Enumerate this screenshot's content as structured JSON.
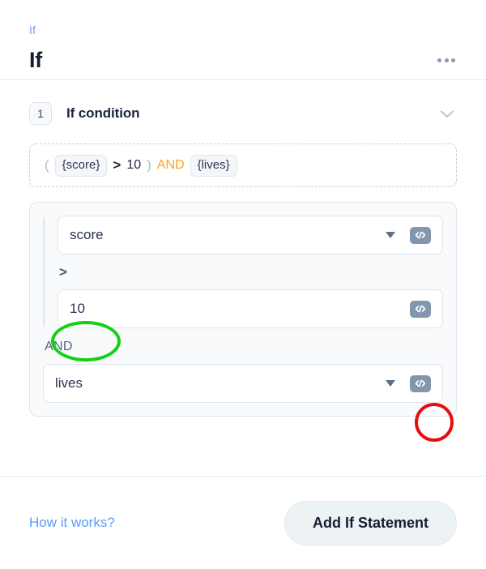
{
  "header": {
    "breadcrumb": "If",
    "title": "If",
    "menu_icon": "kebab-menu-icon"
  },
  "section": {
    "step_number": "1",
    "title": "If condition",
    "collapse_icon": "chevron-down-icon"
  },
  "preview": {
    "open_paren": "(",
    "left_token": "{score}",
    "operator": ">",
    "value": "10",
    "close_paren": ")",
    "conjunction": "AND",
    "right_token": "{lives}"
  },
  "builder": {
    "rows": [
      {
        "type": "select",
        "name": "left-operand",
        "value": "score",
        "has_dropdown": true,
        "code_icon": "code-icon"
      },
      {
        "type": "operator",
        "name": "comparison-operator",
        "value": ">"
      },
      {
        "type": "input",
        "name": "right-operand",
        "value": "10",
        "has_dropdown": false,
        "code_icon": "code-icon"
      },
      {
        "type": "conjunction",
        "name": "logical-conjunction",
        "value": "AND"
      },
      {
        "type": "select",
        "name": "second-condition",
        "value": "lives",
        "has_dropdown": true,
        "code_icon": "code-icon"
      }
    ]
  },
  "footer": {
    "how_it_works": "How it works?",
    "add_button": "Add If Statement"
  },
  "annotations": {
    "green_ellipse": {
      "target": "value-10",
      "color": "#12d012"
    },
    "red_ellipse": {
      "target": "code-button-lives",
      "color": "#e60f0f"
    }
  }
}
